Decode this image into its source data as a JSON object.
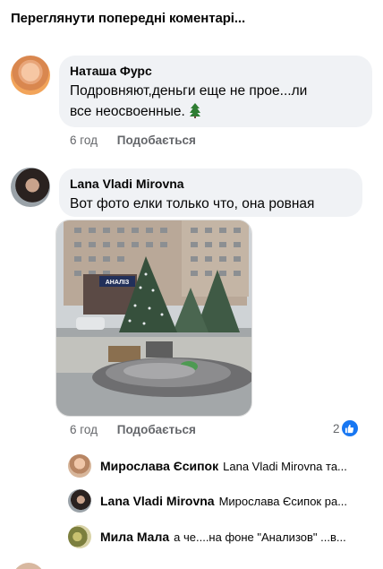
{
  "view_previous": "Переглянути попередні коментарі...",
  "comments": [
    {
      "author": "Наташа Фурс",
      "text_line1": "Подровняют,деньги еще не прое...ли",
      "text_line2": "все неосвоенные.",
      "emoji_icon": "christmas-tree-icon",
      "time": "6 год",
      "like": "Подобається"
    },
    {
      "author": "Lana Vladi Mirovna",
      "text": "Вот фото елки только что, она ровная",
      "time": "6 год",
      "like": "Подобається",
      "reaction_count": "2",
      "photo_sign": "АНАЛІЗ"
    }
  ],
  "replies": [
    {
      "author": "Мирослава Єсипок",
      "text": "Lana Vladi Mirovna та..."
    },
    {
      "author": "Lana Vladi Mirovna",
      "text": "Мирослава Єсипок ра..."
    },
    {
      "author": "Мила Мала",
      "text": "а че....на фоне \"Анализов\" ...в..."
    }
  ],
  "colors": {
    "bubble": "#f0f2f5",
    "meta": "#65676b",
    "like_blue": "#1877f2"
  }
}
